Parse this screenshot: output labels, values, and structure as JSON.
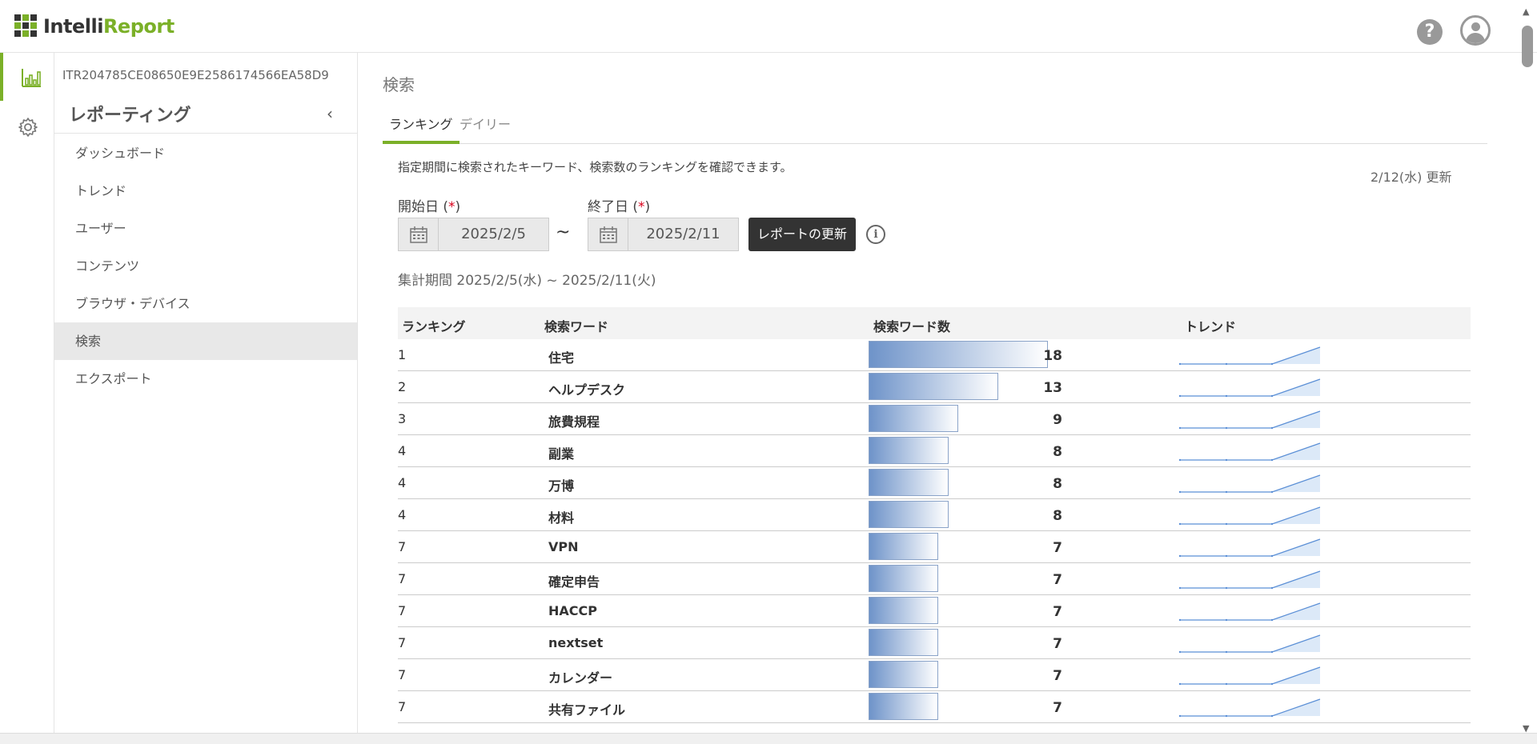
{
  "header": {
    "logo_part1": "Intelli",
    "logo_part2": "Report",
    "help_label": "?"
  },
  "rail": {
    "items": [
      {
        "icon": "bar-chart-icon",
        "active": true
      },
      {
        "icon": "gear-icon",
        "active": false
      }
    ]
  },
  "sidebar": {
    "report_id": "ITR204785CE08650E9E2586174566EA58D9",
    "section_title": "レポーティング",
    "collapse_icon": "‹",
    "items": [
      {
        "label": "ダッシュボード"
      },
      {
        "label": "トレンド"
      },
      {
        "label": "ユーザー"
      },
      {
        "label": "コンテンツ"
      },
      {
        "label": "ブラウザ・デバイス"
      },
      {
        "label": "検索"
      },
      {
        "label": "エクスポート"
      }
    ],
    "active_index": 5
  },
  "main": {
    "title": "検索",
    "tabs": [
      {
        "label": "ランキング"
      },
      {
        "label": "デイリー"
      }
    ],
    "description": "指定期間に検索されたキーワード、検索数のランキングを確認できます。",
    "updated": "2/12(水) 更新",
    "start_label": "開始日 (",
    "end_label": "終了日 (",
    "required_mark": "*",
    "close_paren": ")",
    "start_date": "2025/2/5",
    "end_date": "2025/2/11",
    "tilde": "~",
    "update_button": "レポートの更新",
    "info_label": "i",
    "period": "集計期間 2025/2/5(水) ~ 2025/2/11(火)"
  },
  "table": {
    "columns": [
      "ランキング",
      "検索ワード",
      "検索ワード数",
      "トレンド"
    ],
    "max_count": 18,
    "rows": [
      {
        "rank": "1",
        "word": "住宅",
        "count": "18"
      },
      {
        "rank": "2",
        "word": "ヘルプデスク",
        "count": "13"
      },
      {
        "rank": "3",
        "word": "旅費規程",
        "count": "9"
      },
      {
        "rank": "4",
        "word": "副業",
        "count": "8"
      },
      {
        "rank": "4",
        "word": "万博",
        "count": "8"
      },
      {
        "rank": "4",
        "word": "材料",
        "count": "8"
      },
      {
        "rank": "7",
        "word": "VPN",
        "count": "7"
      },
      {
        "rank": "7",
        "word": "確定申告",
        "count": "7"
      },
      {
        "rank": "7",
        "word": "HACCP",
        "count": "7"
      },
      {
        "rank": "7",
        "word": "nextset",
        "count": "7"
      },
      {
        "rank": "7",
        "word": "カレンダー",
        "count": "7"
      },
      {
        "rank": "7",
        "word": "共有ファイル",
        "count": "7"
      }
    ]
  },
  "colors": {
    "accent": "#7bb028",
    "bar_start": "#6e93c9",
    "trend_line": "#5b8fd6",
    "trend_fill": "#dce9f8"
  }
}
